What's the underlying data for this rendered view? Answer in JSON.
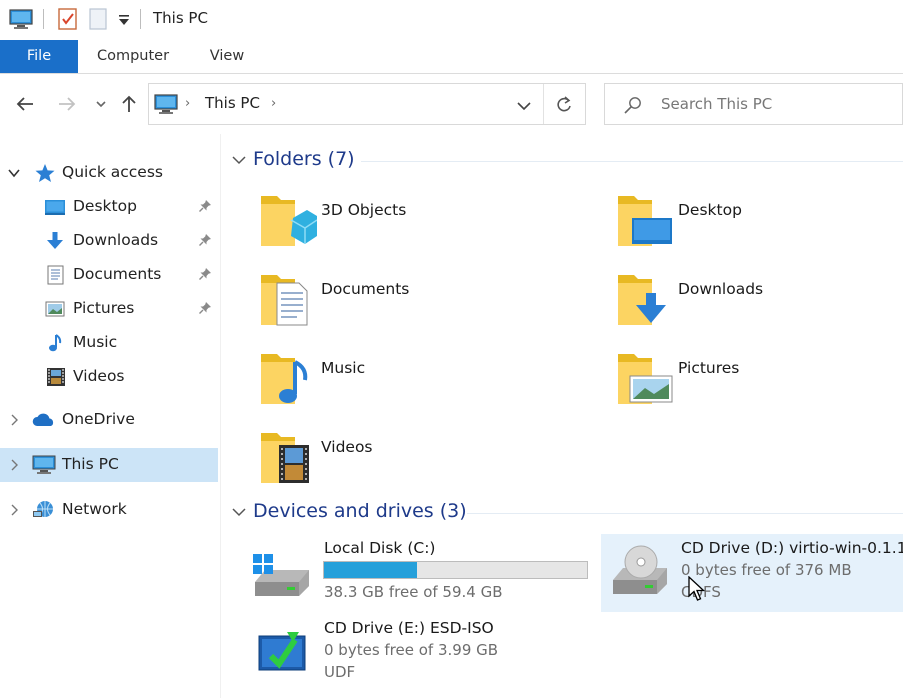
{
  "titlebar": {
    "title": "This PC"
  },
  "ribbon": {
    "tabs": [
      "File",
      "Computer",
      "View"
    ]
  },
  "address": {
    "path_item": "This PC"
  },
  "search": {
    "placeholder": "Search This PC"
  },
  "nav": {
    "quick_access": "Quick access",
    "pinned": [
      {
        "label": "Desktop",
        "icon": "desktop-icon",
        "pinned": true
      },
      {
        "label": "Downloads",
        "icon": "downloads-icon",
        "pinned": true
      },
      {
        "label": "Documents",
        "icon": "documents-icon",
        "pinned": true
      },
      {
        "label": "Pictures",
        "icon": "pictures-icon",
        "pinned": true
      },
      {
        "label": "Music",
        "icon": "music-icon",
        "pinned": false
      },
      {
        "label": "Videos",
        "icon": "videos-icon",
        "pinned": false
      }
    ],
    "onedrive": "OneDrive",
    "this_pc": "This PC",
    "network": "Network"
  },
  "folders": {
    "header": "Folders (7)",
    "items": [
      {
        "name": "3D Objects",
        "icon": "3d-objects-folder-icon"
      },
      {
        "name": "Desktop",
        "icon": "desktop-folder-icon"
      },
      {
        "name": "Documents",
        "icon": "documents-folder-icon"
      },
      {
        "name": "Downloads",
        "icon": "downloads-folder-icon"
      },
      {
        "name": "Music",
        "icon": "music-folder-icon"
      },
      {
        "name": "Pictures",
        "icon": "pictures-folder-icon"
      },
      {
        "name": "Videos",
        "icon": "videos-folder-icon"
      }
    ]
  },
  "drives": {
    "header": "Devices and drives (3)",
    "items": [
      {
        "name": "Local Disk (C:)",
        "sub1": "38.3 GB free of 59.4 GB",
        "used_fraction": 0.355,
        "icon": "hard-disk-icon"
      },
      {
        "name": "CD Drive (D:) virtio-win-0.1.1",
        "sub1": "0 bytes free of 376 MB",
        "sub2": "CDFS",
        "icon": "cd-drive-icon"
      },
      {
        "name": "CD Drive (E:) ESD-ISO",
        "sub1": "0 bytes free of 3.99 GB",
        "sub2": "UDF",
        "icon": "cd-install-icon"
      }
    ]
  },
  "colors": {
    "accent": "#1a6fc9",
    "selected_bg": "#cce4f7",
    "hover_bg": "#e5f1fb",
    "bar_fill": "#26a0da",
    "header_text": "#1e3a8a"
  }
}
